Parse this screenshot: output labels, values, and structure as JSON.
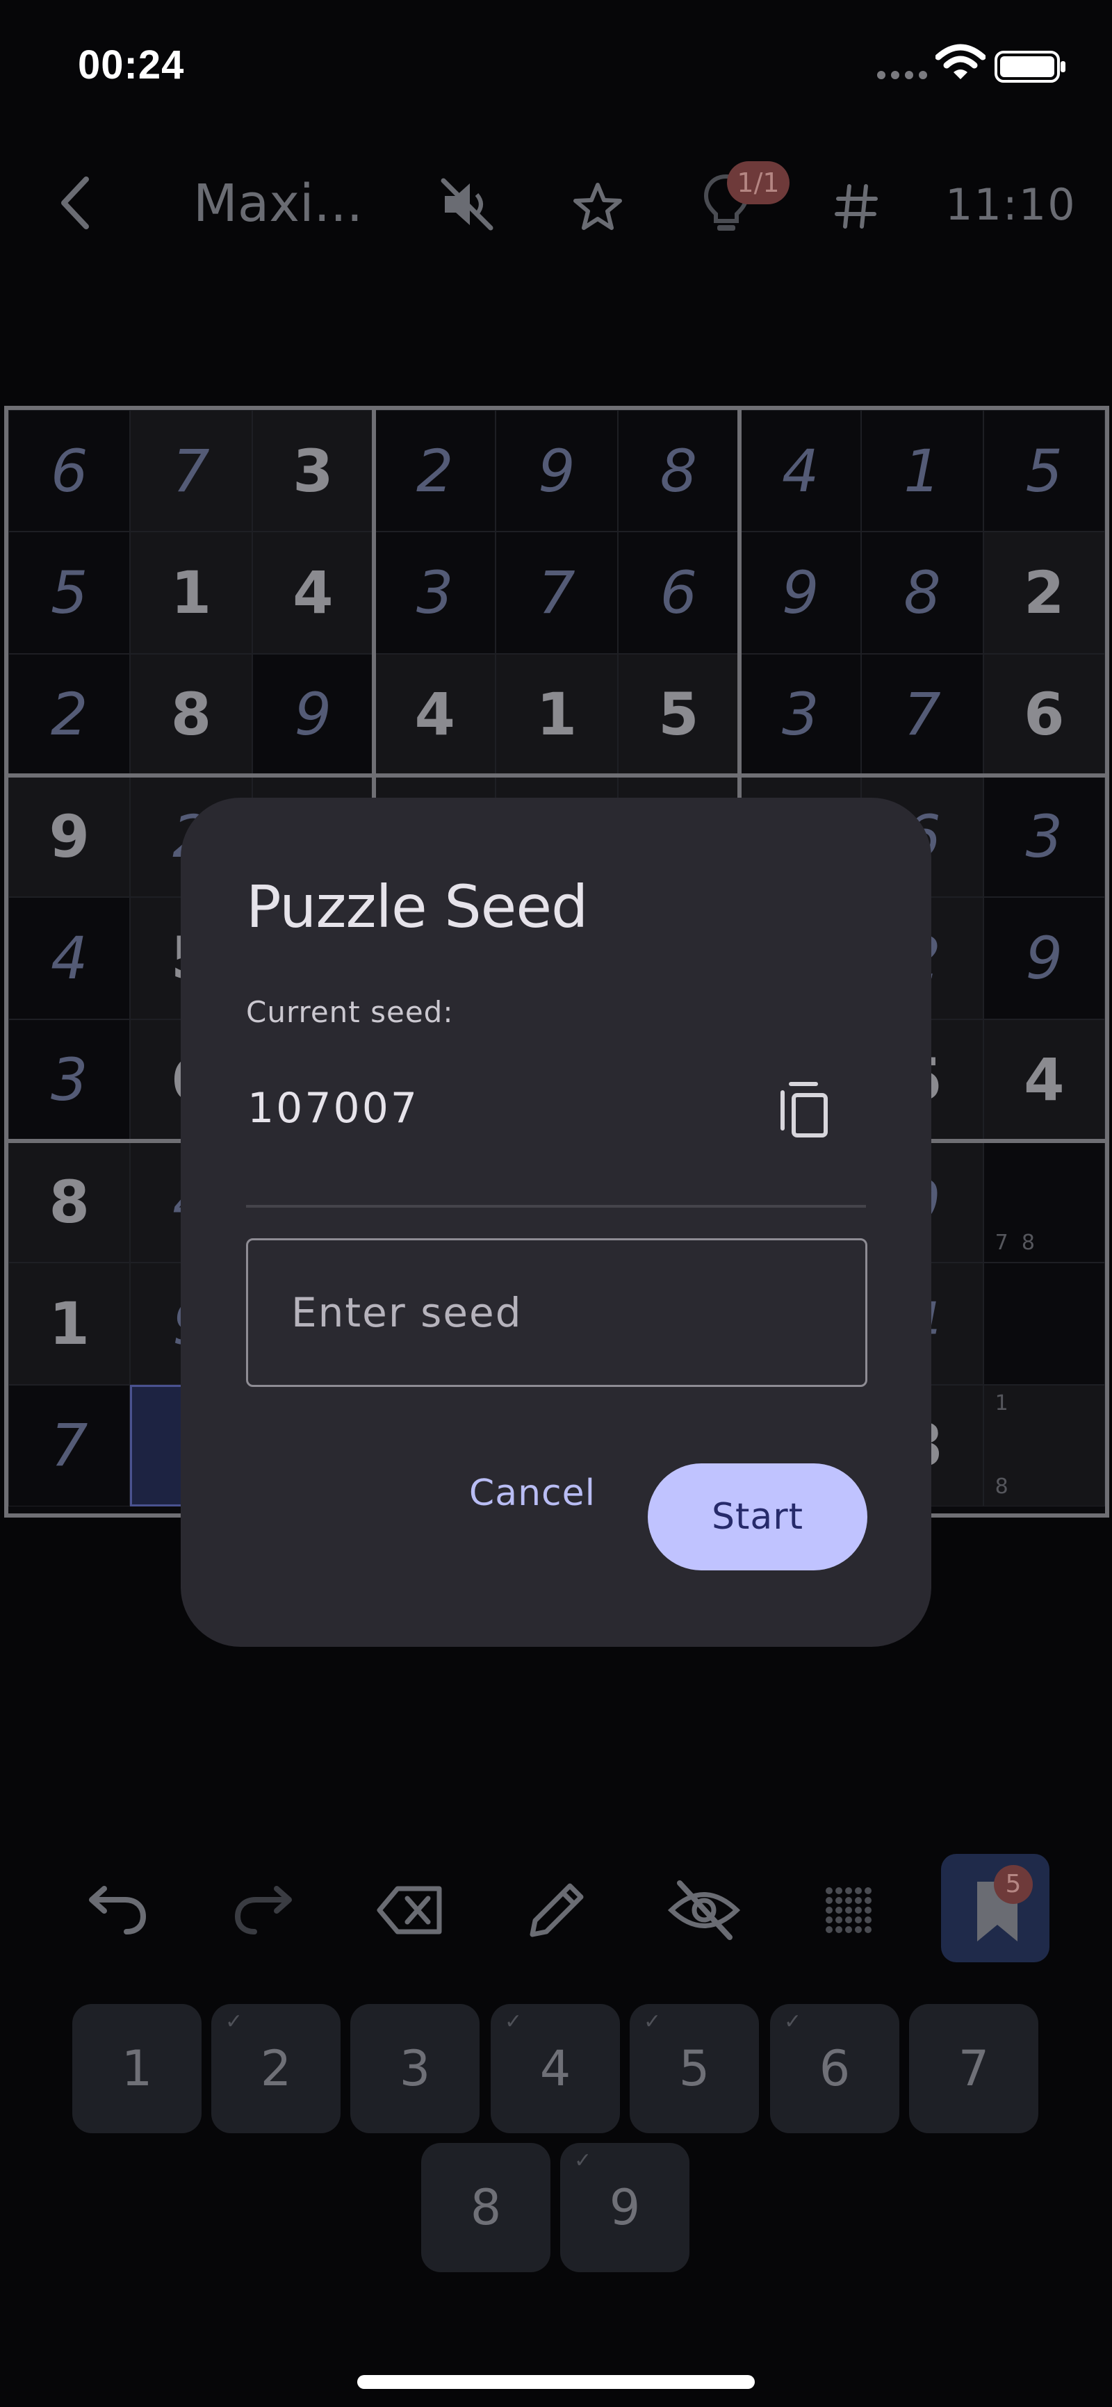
{
  "status_bar": {
    "time": "00:24"
  },
  "header": {
    "title": "Maxi...",
    "timer": "11:10",
    "hint_badge": "1/1",
    "icons": [
      "back-arrow-icon",
      "sound-off-icon",
      "star-icon",
      "lightbulb-icon",
      "hash-icon"
    ]
  },
  "board": {
    "cells": [
      [
        "6",
        "7",
        "3",
        "2",
        "9",
        "8",
        "4",
        "1",
        "5"
      ],
      [
        "5",
        "1",
        "4",
        "3",
        "7",
        "6",
        "9",
        "8",
        "2"
      ],
      [
        "2",
        "8",
        "9",
        "4",
        "1",
        "5",
        "3",
        "7",
        "6"
      ],
      [
        "9",
        "2",
        "",
        "",
        "",
        "",
        "",
        "6",
        "3"
      ],
      [
        "4",
        "5",
        "",
        "",
        "",
        "",
        "",
        "2",
        "9"
      ],
      [
        "3",
        "6",
        "",
        "",
        "",
        "",
        "",
        "5",
        "4"
      ],
      [
        "8",
        "4",
        "",
        "",
        "",
        "",
        "",
        "9",
        ""
      ],
      [
        "1",
        "9",
        "",
        "",
        "",
        "",
        "",
        "4",
        ""
      ],
      [
        "7",
        "",
        "",
        "",
        "",
        "",
        "",
        "8",
        ""
      ]
    ],
    "given": [
      [
        0,
        0,
        1,
        0,
        0,
        0,
        0,
        0,
        0
      ],
      [
        0,
        1,
        1,
        0,
        0,
        0,
        0,
        0,
        1
      ],
      [
        0,
        1,
        0,
        1,
        1,
        1,
        0,
        0,
        1
      ],
      [
        1,
        0,
        0,
        0,
        0,
        0,
        0,
        0,
        0
      ],
      [
        0,
        1,
        0,
        0,
        0,
        0,
        0,
        0,
        0
      ],
      [
        0,
        1,
        0,
        0,
        0,
        0,
        0,
        1,
        1
      ],
      [
        1,
        0,
        0,
        0,
        0,
        0,
        0,
        0,
        0
      ],
      [
        1,
        0,
        0,
        0,
        0,
        0,
        0,
        0,
        0
      ],
      [
        0,
        0,
        0,
        0,
        0,
        0,
        0,
        1,
        0
      ]
    ],
    "notes": [
      {
        "row": 6,
        "col": 8,
        "text": "7  8",
        "pos": "bottom"
      },
      {
        "row": 8,
        "col": 8,
        "text": "1",
        "pos": "top"
      },
      {
        "row": 8,
        "col": 8,
        "text": "8",
        "pos": "bottom"
      }
    ]
  },
  "dialog": {
    "title": "Puzzle Seed",
    "current_seed_label": "Current seed:",
    "current_seed_value": "107007",
    "input_placeholder": "Enter seed",
    "input_value": "",
    "cancel_label": "Cancel",
    "start_label": "Start"
  },
  "toolbar": {
    "icons": [
      "undo-icon",
      "redo-icon",
      "erase-icon",
      "pencil-icon",
      "hide-icon",
      "grid-dots-icon",
      "bookmark-icon"
    ],
    "notes_badge": "5"
  },
  "number_pad": {
    "keys": [
      {
        "label": "1",
        "checked": false
      },
      {
        "label": "2",
        "checked": true
      },
      {
        "label": "3",
        "checked": false
      },
      {
        "label": "4",
        "checked": true
      },
      {
        "label": "5",
        "checked": true
      },
      {
        "label": "6",
        "checked": true
      },
      {
        "label": "7",
        "checked": false
      },
      {
        "label": "8",
        "checked": false
      },
      {
        "label": "9",
        "checked": true
      }
    ],
    "check_mark": "✓"
  },
  "colors": {
    "dialog_bg": "#2a2930",
    "primary_button": "#c0c3ff",
    "accent_text": "#b9bdf4",
    "badge_bg": "#6e3a3a"
  }
}
